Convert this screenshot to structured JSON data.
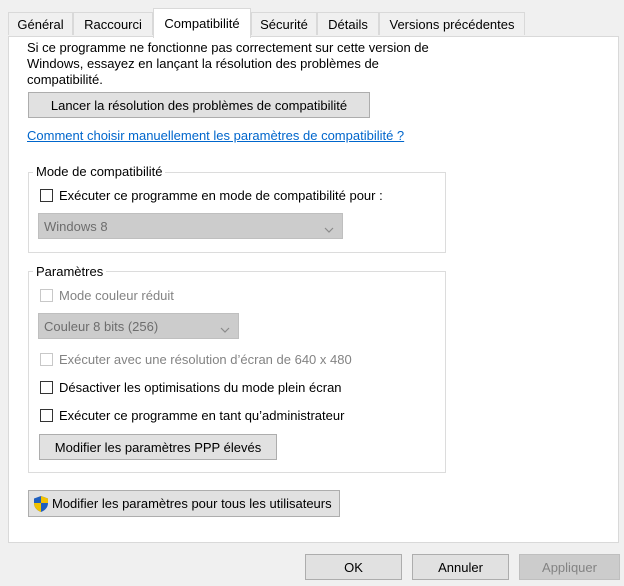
{
  "tabs": [
    "Général",
    "Raccourci",
    "Compatibilité",
    "Sécurité",
    "Détails",
    "Versions précédentes"
  ],
  "intro": {
    "line1": "Si ce programme ne fonctionne pas correctement sur cette version de",
    "line2": "Windows, essayez en lançant la résolution des problèmes de",
    "line3": "compatibilité."
  },
  "troubleshoot_button": "Lancer la résolution des problèmes de compatibilité",
  "help_link": "Comment choisir manuellement les paramètres de compatibilité ?",
  "compat_mode": {
    "legend": "Mode de compatibilité",
    "checkbox_label": "Exécuter ce programme en mode de compatibilité pour :",
    "checked": false,
    "selected_os": "Windows 8"
  },
  "settings": {
    "legend": "Paramètres",
    "reduced_color_label": "Mode couleur réduit",
    "color_mode_value": "Couleur 8 bits (256)",
    "resolution_label": "Exécuter avec une résolution d’écran de 640 x 480",
    "fullscreen_opt_label": "Désactiver les optimisations du mode plein écran",
    "admin_label": "Exécuter ce programme en tant qu’administrateur",
    "dpi_button": "Modifier les paramètres PPP élevés"
  },
  "all_users_button": "Modifier les paramètres pour tous les utilisateurs",
  "footer": {
    "ok": "OK",
    "cancel": "Annuler",
    "apply": "Appliquer"
  },
  "colors": {
    "link": "#0066cc",
    "shield_blue": "#1f5fbf",
    "shield_yellow": "#f2c200"
  }
}
